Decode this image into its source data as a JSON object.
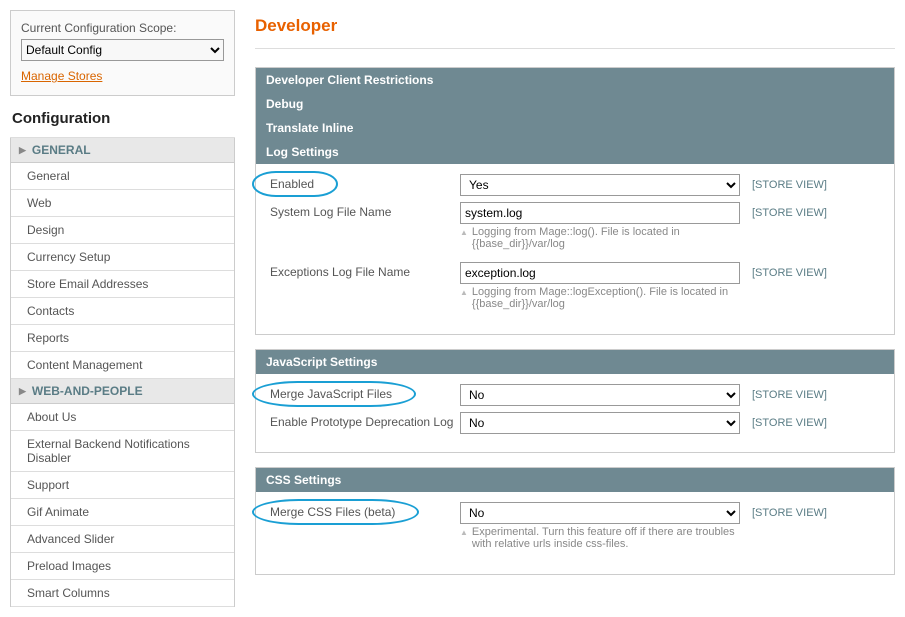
{
  "sidebar": {
    "scope_label": "Current Configuration Scope:",
    "scope_value": "Default Config",
    "manage_stores": "Manage Stores",
    "heading": "Configuration",
    "groups": [
      {
        "title": "GENERAL",
        "items": [
          "General",
          "Web",
          "Design",
          "Currency Setup",
          "Store Email Addresses",
          "Contacts",
          "Reports",
          "Content Management"
        ]
      },
      {
        "title": "WEB-AND-PEOPLE",
        "items": [
          "About Us",
          "External Backend Notifications Disabler",
          "Support",
          "Gif Animate",
          "Advanced Slider",
          "Preload Images",
          "Smart Columns"
        ]
      }
    ]
  },
  "main": {
    "title": "Developer",
    "scope_link": "[STORE VIEW]",
    "panels": [
      {
        "title": "Developer Client Restrictions",
        "collapsed": true
      },
      {
        "title": "Debug",
        "collapsed": true
      },
      {
        "title": "Translate Inline",
        "collapsed": true
      },
      {
        "title": "Log Settings",
        "collapsed": false,
        "fields": [
          {
            "label": "Enabled",
            "type": "select",
            "value": "Yes",
            "circled": true
          },
          {
            "label": "System Log File Name",
            "type": "text",
            "value": "system.log",
            "hint": "Logging from Mage::log(). File is located in {{base_dir}}/var/log"
          },
          {
            "label": "Exceptions Log File Name",
            "type": "text",
            "value": "exception.log",
            "hint": "Logging from Mage::logException(). File is located in {{base_dir}}/var/log"
          }
        ]
      },
      {
        "title": "JavaScript Settings",
        "collapsed": false,
        "fields": [
          {
            "label": "Merge JavaScript Files",
            "type": "select",
            "value": "No",
            "circled": true
          },
          {
            "label": "Enable Prototype Deprecation Log",
            "type": "select",
            "value": "No"
          }
        ]
      },
      {
        "title": "CSS Settings",
        "collapsed": false,
        "fields": [
          {
            "label": "Merge CSS Files (beta)",
            "type": "select",
            "value": "No",
            "circled": true,
            "hint": "Experimental. Turn this feature off if there are troubles with relative urls inside css-files."
          }
        ]
      }
    ]
  }
}
